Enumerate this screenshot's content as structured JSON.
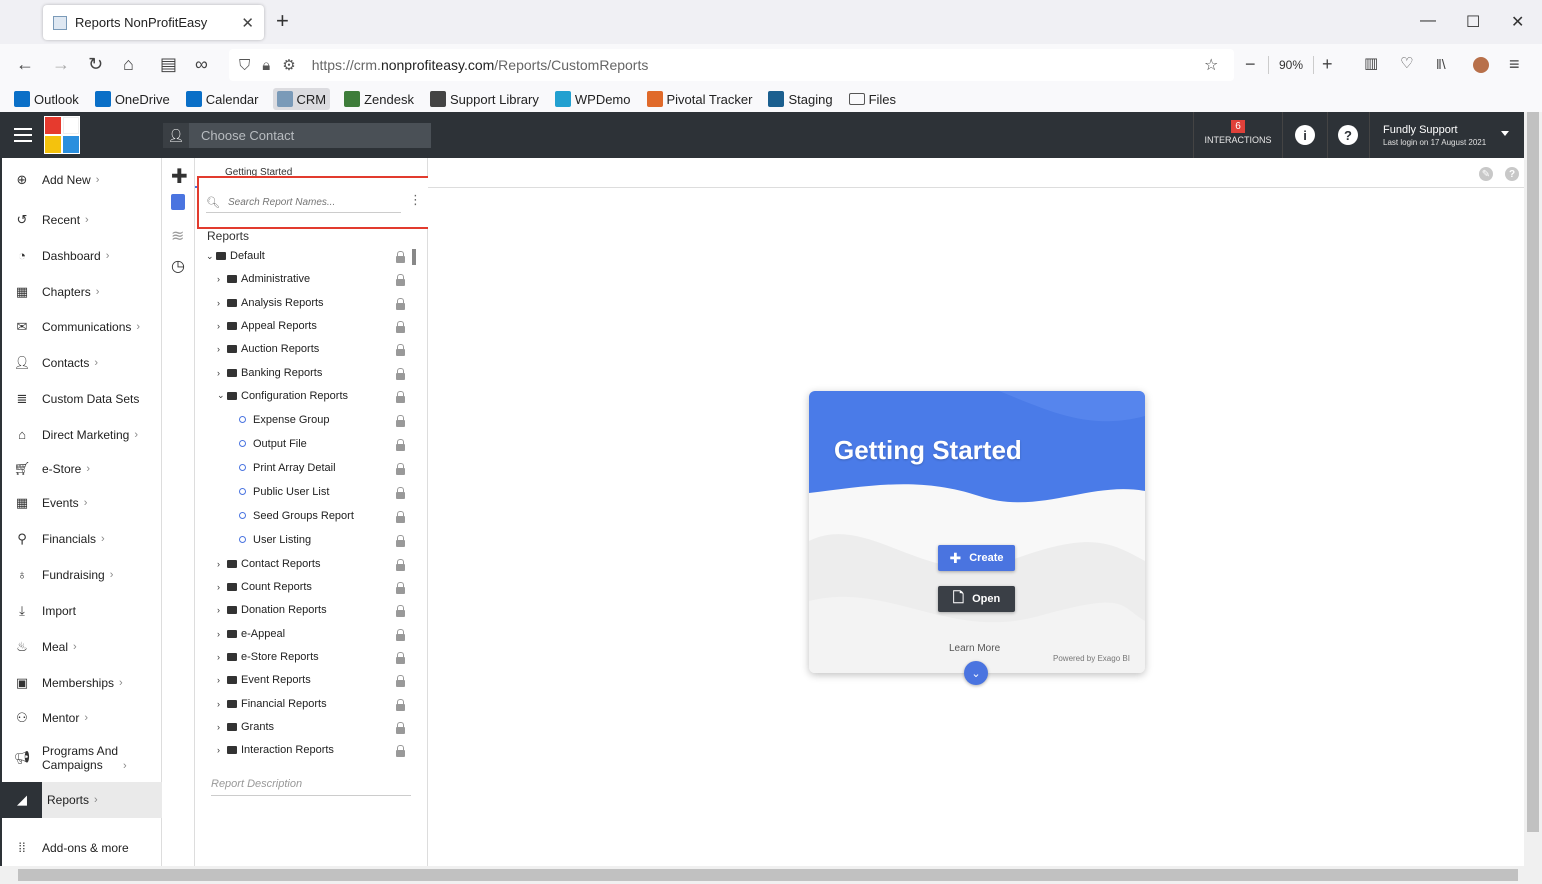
{
  "browser": {
    "tab_title": "Reports NonProfitEasy",
    "url_prefix": "https://crm.",
    "url_domain": "nonprofiteasy.com",
    "url_path": "/Reports/CustomReports",
    "zoom": "90%",
    "bookmarks": [
      {
        "label": "Outlook",
        "color": "#0a6fc7"
      },
      {
        "label": "OneDrive",
        "color": "#0a6fc7"
      },
      {
        "label": "Calendar",
        "color": "#0a6fc7"
      },
      {
        "label": "CRM",
        "color": "#7a9ab8"
      },
      {
        "label": "Zendesk",
        "color": "#3e7d3a"
      },
      {
        "label": "Support Library",
        "color": "#444444"
      },
      {
        "label": "WPDemo",
        "color": "#22a0d0"
      },
      {
        "label": "Pivotal Tracker",
        "color": "#e06a2a"
      },
      {
        "label": "Staging",
        "color": "#1b5f8f"
      },
      {
        "label": "Files",
        "color": "#555555"
      }
    ]
  },
  "header": {
    "contact_placeholder": "Choose Contact",
    "interactions_count": "6",
    "interactions_label": "INTERACTIONS",
    "user_name": "Fundly Support",
    "last_login": "Last login on 17 August 2021"
  },
  "sidebar": {
    "items": [
      {
        "label": "Add New",
        "icon": "plus-circle-icon"
      },
      {
        "label": "Recent",
        "icon": "history-icon"
      },
      {
        "label": "Dashboard",
        "icon": "dashboard-icon"
      },
      {
        "label": "Chapters",
        "icon": "grid-icon"
      },
      {
        "label": "Communications",
        "icon": "envelope-icon"
      },
      {
        "label": "Contacts",
        "icon": "person-icon"
      },
      {
        "label": "Custom Data Sets",
        "icon": "database-icon"
      },
      {
        "label": "Direct Marketing",
        "icon": "building-icon"
      },
      {
        "label": "e-Store",
        "icon": "cart-icon"
      },
      {
        "label": "Events",
        "icon": "calendar-icon"
      },
      {
        "label": "Financials",
        "icon": "money-icon"
      },
      {
        "label": "Fundraising",
        "icon": "moneybag-icon"
      },
      {
        "label": "Import",
        "icon": "import-icon"
      },
      {
        "label": "Meal",
        "icon": "utensils-icon"
      },
      {
        "label": "Memberships",
        "icon": "id-card-icon"
      },
      {
        "label": "Mentor",
        "icon": "mentor-icon"
      },
      {
        "label": "Programs And",
        "label2": "Campaigns",
        "icon": "megaphone-icon"
      },
      {
        "label": "Reports",
        "icon": "chart-icon"
      },
      {
        "label": "Add-ons & more",
        "icon": "apps-icon"
      }
    ]
  },
  "panel": {
    "tab_label": "Getting Started",
    "search_placeholder": "Search Report Names...",
    "reports_heading": "Reports",
    "description_placeholder": "Report Description",
    "tree": [
      {
        "label": "Default",
        "kind": "folder",
        "open": true,
        "level": 0
      },
      {
        "label": "Administrative",
        "kind": "folder",
        "level": 1
      },
      {
        "label": "Analysis Reports",
        "kind": "folder",
        "level": 1
      },
      {
        "label": "Appeal Reports",
        "kind": "folder",
        "level": 1
      },
      {
        "label": "Auction Reports",
        "kind": "folder",
        "level": 1
      },
      {
        "label": "Banking Reports",
        "kind": "folder",
        "level": 1
      },
      {
        "label": "Configuration Reports",
        "kind": "folder",
        "open": true,
        "level": 1
      },
      {
        "label": "Expense Group",
        "kind": "report",
        "level": 2
      },
      {
        "label": "Output File",
        "kind": "report",
        "level": 2
      },
      {
        "label": "Print Array Detail",
        "kind": "report",
        "level": 2
      },
      {
        "label": "Public User List",
        "kind": "report",
        "level": 2
      },
      {
        "label": "Seed Groups Report",
        "kind": "report",
        "level": 2
      },
      {
        "label": "User Listing",
        "kind": "report",
        "level": 2
      },
      {
        "label": "Contact Reports",
        "kind": "folder",
        "level": 1
      },
      {
        "label": "Count Reports",
        "kind": "folder",
        "level": 1
      },
      {
        "label": "Donation Reports",
        "kind": "folder",
        "level": 1
      },
      {
        "label": "e-Appeal",
        "kind": "folder",
        "level": 1
      },
      {
        "label": "e-Store Reports",
        "kind": "folder",
        "level": 1
      },
      {
        "label": "Event Reports",
        "kind": "folder",
        "level": 1
      },
      {
        "label": "Financial Reports",
        "kind": "folder",
        "level": 1
      },
      {
        "label": "Grants",
        "kind": "folder",
        "level": 1
      },
      {
        "label": "Interaction Reports",
        "kind": "folder",
        "level": 1
      }
    ]
  },
  "card": {
    "title": "Getting Started",
    "create_label": "Create",
    "open_label": "Open",
    "learn_more": "Learn More",
    "powered_by": "Powered by Exago BI",
    "accent": "#4a74e0"
  }
}
